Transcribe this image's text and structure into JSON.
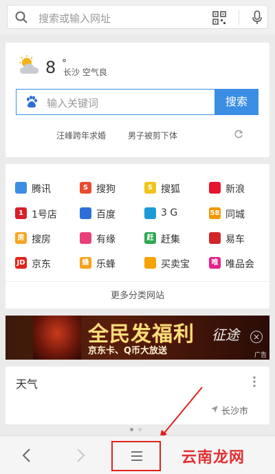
{
  "search_bar": {
    "placeholder": "搜索或输入网址"
  },
  "weather": {
    "temperature": "8",
    "degree_symbol": "°",
    "summary": "长沙  空气良"
  },
  "keyword_search": {
    "placeholder": "输入关键词",
    "button_label": "搜索"
  },
  "hot_words": [
    "汪峰跨年求婚",
    "男子被剪下体"
  ],
  "sites": [
    {
      "label": "腾讯",
      "icon": "tencent-icon",
      "color": "#3b8ee4"
    },
    {
      "label": "搜狗",
      "icon": "sogou-icon",
      "color": "#e94b2f"
    },
    {
      "label": "搜狐",
      "icon": "sohu-icon",
      "color": "#f0c419"
    },
    {
      "label": "新浪",
      "icon": "sina-icon",
      "color": "#e6162d"
    },
    {
      "label": "1号店",
      "icon": "yhd-icon",
      "color": "#d6202a"
    },
    {
      "label": "百度",
      "icon": "baidu-icon",
      "color": "#2d6fd8"
    },
    {
      "label": "3 G",
      "icon": "3g-icon",
      "color": "#1c9bd8"
    },
    {
      "label": "同城",
      "icon": "58-icon",
      "color": "#f39800"
    },
    {
      "label": "搜房",
      "icon": "soufang-icon",
      "color": "#f5a623"
    },
    {
      "label": "有缘",
      "icon": "youyuan-icon",
      "color": "#e8417a"
    },
    {
      "label": "赶集",
      "icon": "ganji-icon",
      "color": "#2fa84f"
    },
    {
      "label": "易车",
      "icon": "yiche-icon",
      "color": "#d0262c"
    },
    {
      "label": "京东",
      "icon": "jd-icon",
      "color": "#e1251b"
    },
    {
      "label": "乐蜂",
      "icon": "lefeng-icon",
      "color": "#f7a21b"
    },
    {
      "label": "买卖宝",
      "icon": "maimaibao-icon",
      "color": "#f4a300"
    },
    {
      "label": "唯品会",
      "icon": "vip-icon",
      "color": "#e6218c"
    }
  ],
  "site_glyphs": [
    "",
    "S",
    "S",
    "",
    "1",
    "",
    "",
    "58",
    "房",
    "",
    "赶",
    "",
    "JD",
    "蜂",
    "",
    "唯"
  ],
  "more_sites_label": "更多分类网站",
  "ad_banner": {
    "headline": "全民发福利",
    "subline": "京东卡、Q币大放送",
    "brand": "征途",
    "ad_mark": "广告"
  },
  "weather_card": {
    "title": "天气",
    "location": "长沙市"
  },
  "colors": {
    "accent": "#3b8ee4",
    "highlight": "#e02020"
  },
  "watermark": "云南龙网"
}
